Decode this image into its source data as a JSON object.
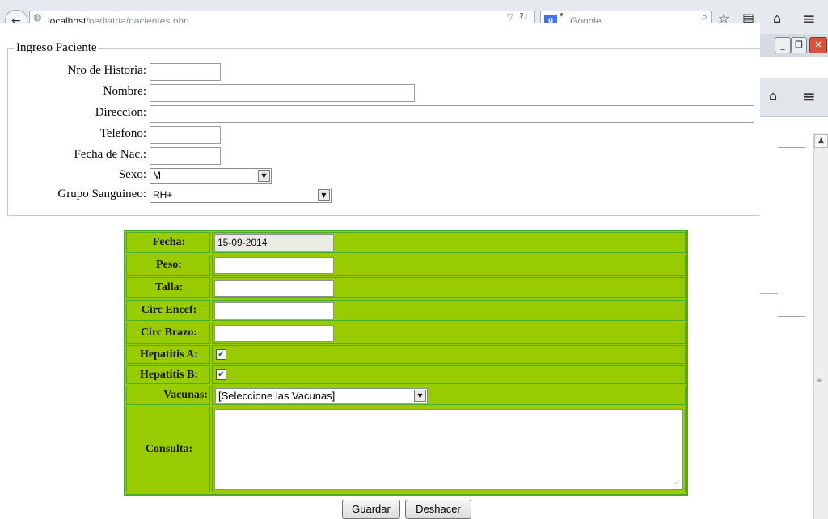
{
  "browser": {
    "url_host": "localhost",
    "url_path": "/pediatria/pacientes.php",
    "search_placeholder": "Google",
    "search_engine_badge": "g",
    "icons": {
      "back": "back-arrow-icon",
      "globe": "globe-icon",
      "reload": "reload-icon",
      "search": "magnifier-icon",
      "star": "star-icon",
      "bookmarks": "bookmarks-icon",
      "home": "home-icon",
      "menu": "hamburger-menu-icon"
    }
  },
  "patient_form": {
    "legend": "Ingreso Paciente",
    "fields": {
      "historia": {
        "label": "Nro de Historia:",
        "value": ""
      },
      "nombre": {
        "label": "Nombre:",
        "value": ""
      },
      "direccion": {
        "label": "Direccion:",
        "value": ""
      },
      "telefono": {
        "label": "Telefono:",
        "value": ""
      },
      "fecha_nac": {
        "label": "Fecha de Nac.:",
        "value": ""
      },
      "sexo": {
        "label": "Sexo:",
        "selected": "M"
      },
      "grupo": {
        "label": "Grupo Sanguineo:",
        "selected": "RH+"
      }
    }
  },
  "consulta_form": {
    "fecha": {
      "label": "Fecha:",
      "value": "15-09-2014"
    },
    "peso": {
      "label": "Peso:",
      "value": ""
    },
    "talla": {
      "label": "Talla:",
      "value": ""
    },
    "circ_encef": {
      "label": "Circ Encef:",
      "value": ""
    },
    "circ_brazo": {
      "label": "Circ Brazo:",
      "value": ""
    },
    "hepatitis_a": {
      "label": "Hepatitis A:",
      "checked": true
    },
    "hepatitis_b": {
      "label": "Hepatitis B:",
      "checked": true
    },
    "vacunas": {
      "label": "Vacunas:",
      "selected": "[Seleccione las Vacunas]"
    },
    "consulta": {
      "label": "Consulta:",
      "value": ""
    },
    "colors": {
      "background": "#99cc00",
      "border": "#4daa2a"
    }
  },
  "buttons": {
    "guardar": "Guardar",
    "deshacer": "Deshacer"
  }
}
